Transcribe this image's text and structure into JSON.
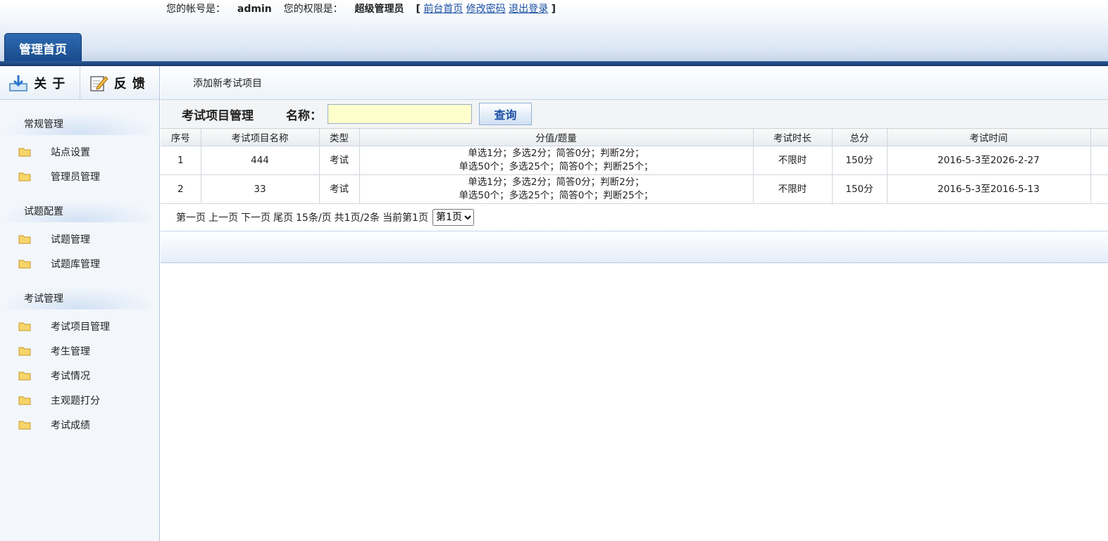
{
  "header": {
    "account_label": "您的帐号是：",
    "account_value": "admin",
    "role_label": "您的权限是：",
    "role_value": "超级管理员",
    "bracket_open": "[",
    "bracket_close": "]",
    "links": [
      "前台首页",
      "修改密码",
      "退出登录"
    ],
    "tab_home": "管理首页",
    "bar_color": "#1e4a82"
  },
  "sidebar": {
    "top_buttons": [
      {
        "label": "关于",
        "icon": "download-icon"
      },
      {
        "label": "反馈",
        "icon": "edit-icon"
      }
    ],
    "groups": [
      {
        "title": "常规管理",
        "items": [
          "站点设置",
          "管理员管理"
        ]
      },
      {
        "title": "试题配置",
        "items": [
          "试题管理",
          "试题库管理"
        ]
      },
      {
        "title": "考试管理",
        "items": [
          "考试项目管理",
          "考生管理",
          "考试情况",
          "主观题打分",
          "考试成绩"
        ]
      }
    ]
  },
  "main": {
    "add_link": "添加新考试项目",
    "section_title": "考试项目管理",
    "name_label": "名称：",
    "name_value": "",
    "query_button": "查询",
    "columns": [
      "序号",
      "考试项目名称",
      "类型",
      "分值/题量",
      "考试时长",
      "总分",
      "考试时间",
      ""
    ],
    "rows": [
      {
        "no": "1",
        "name": "444",
        "type": "考试",
        "score_line1": "单选1分；多选2分；简答0分；判断2分；",
        "score_line2": "单选50个；多选25个；简答0个；判断25个；",
        "duration": "不限时",
        "total": "150分",
        "time": "2016-5-3至2026-2-27"
      },
      {
        "no": "2",
        "name": "33",
        "type": "考试",
        "score_line1": "单选1分；多选2分；简答0分；判断2分；",
        "score_line2": "单选50个；多选25个；简答0个；判断25个；",
        "duration": "不限时",
        "total": "150分",
        "time": "2016-5-3至2016-5-13"
      }
    ],
    "pager": {
      "first": "第一页",
      "prev": "上一页",
      "next": "下一页",
      "last": "尾页",
      "per_page": "15条/页",
      "total": "共1页/2条",
      "current": "当前第1页",
      "selected": "第1页"
    }
  }
}
